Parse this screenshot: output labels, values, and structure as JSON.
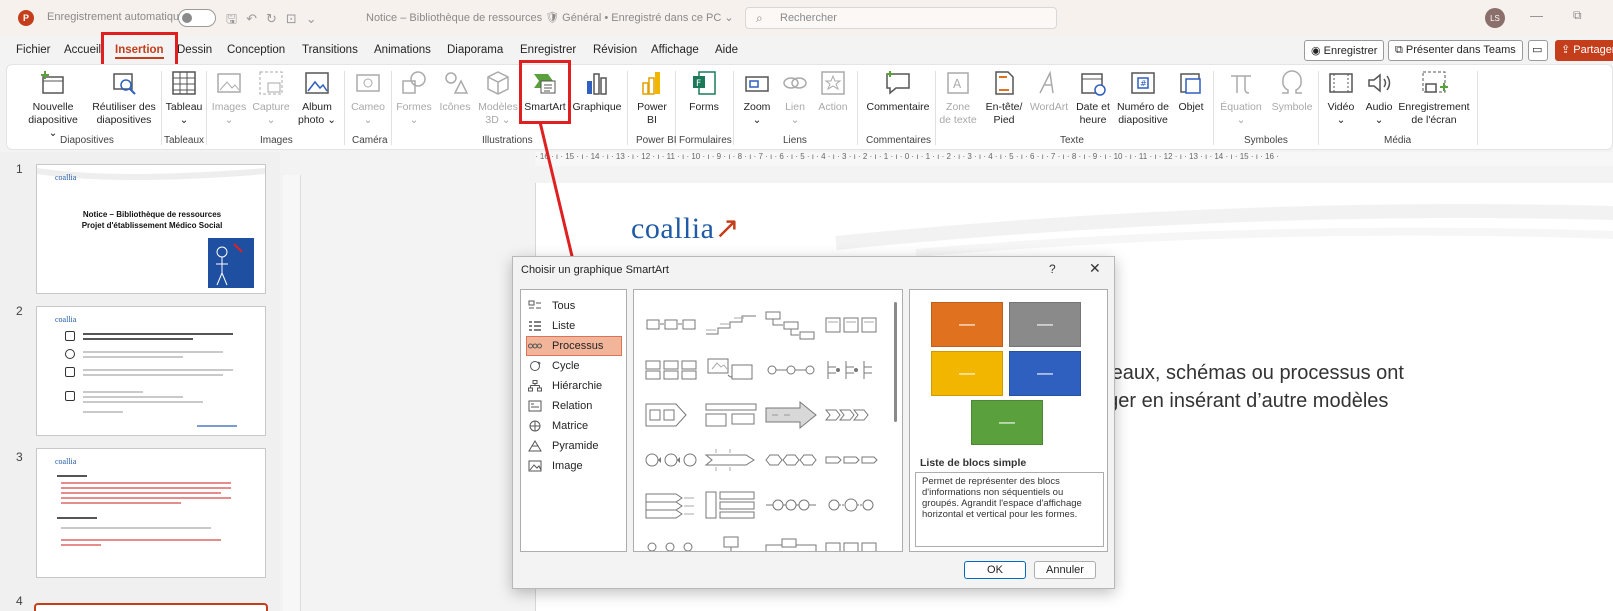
{
  "titlebar": {
    "app_logo": "P",
    "autosave": "Enregistrement automatique",
    "doc_title": "Notice – Bibliothèque de ressources  🛡 Général • Enregistré dans ce PC ⌄",
    "search_placeholder": "Rechercher",
    "user_initials": "LS"
  },
  "menu": {
    "tabs": [
      "Fichier",
      "Accueil",
      "Insertion",
      "Dessin",
      "Conception",
      "Transitions",
      "Animations",
      "Diaporama",
      "Enregistrer",
      "Révision",
      "Affichage",
      "Aide"
    ],
    "record_btn": "Enregistrer",
    "teams_btn": "Présenter dans Teams",
    "share_btn": "Partager"
  },
  "ribbon": {
    "buttons": {
      "nouvelle_diapo": [
        "Nouvelle",
        "diapositive ⌄"
      ],
      "reutiliser": [
        "Réutiliser des",
        "diapositives"
      ],
      "tableau": [
        "Tableau",
        "⌄"
      ],
      "images": [
        "Images",
        "⌄"
      ],
      "capture": [
        "Capture",
        "⌄"
      ],
      "album": [
        "Album",
        "photo ⌄"
      ],
      "cameo": [
        "Cameo",
        "⌄"
      ],
      "formes": [
        "Formes",
        "⌄"
      ],
      "icones": [
        "Icônes"
      ],
      "modeles3d": [
        "Modèles",
        "3D ⌄"
      ],
      "smartart": [
        "SmartArt"
      ],
      "graphique": [
        "Graphique"
      ],
      "powerbi": [
        "Power",
        "BI"
      ],
      "forms": [
        "Forms"
      ],
      "zoom": [
        "Zoom",
        "⌄"
      ],
      "lien": [
        "Lien",
        "⌄"
      ],
      "action": [
        "Action"
      ],
      "commentaire": [
        "Commentaire"
      ],
      "zone_texte": [
        "Zone",
        "de texte"
      ],
      "entete": [
        "En-tête/",
        "Pied"
      ],
      "wordart": [
        "WordArt"
      ],
      "date_heure": [
        "Date et",
        "heure"
      ],
      "numero": [
        "Numéro de",
        "diapositive"
      ],
      "objet": [
        "Objet"
      ],
      "equation": [
        "Équation",
        "⌄"
      ],
      "symbole": [
        "Symbole"
      ],
      "video": [
        "Vidéo",
        "⌄"
      ],
      "audio": [
        "Audio",
        "⌄"
      ],
      "enreg_ecran": [
        "Enregistrement",
        "de l'écran"
      ]
    },
    "groups": [
      "Diapositives",
      "Tableaux",
      "Images",
      "Caméra",
      "Illustrations",
      "Power BI",
      "Formulaires",
      "Liens",
      "Commentaires",
      "Texte",
      "Symboles",
      "Média"
    ]
  },
  "thumbnails": {
    "numbers": [
      "1",
      "2",
      "3",
      "4"
    ],
    "logo": "coallia",
    "slide1_title": "Notice – Bibliothèque de ressources\nProjet d'établissement Médico Social"
  },
  "ruler": {
    "labels": "· 16 · ı · 15 · ı · 14 · ı · 13 · ı · 12 · ı · 11 · ı · 10 · ı · 9 · ı · 8 · ı · 7 · ı · 6 · ı · 5 · ı · 4 · ı · 3 · ı · 2 · ı · 1 · ı · 0 · ı · 1 · ı · 2 · ı · 3 · ı · 4 · ı · 5 · ı · 6 · ı · 7 · ı · 8 · ı · 9 · ı · 10 · ı · 11 · ı · 12 · ı · 13 · ı · 14 · ı · 15 · ı · 16 ·"
  },
  "slide": {
    "logo": "coallia",
    "logo_mark": "↗",
    "text_line1": "bleaux, schémas ou processus ont",
    "text_line2": "nger  en  insérant  d’autre  modèles"
  },
  "dialog": {
    "title": "Choisir un graphique SmartArt",
    "help": "?",
    "close": "✕",
    "categories": [
      "Tous",
      "Liste",
      "Processus",
      "Cycle",
      "Hiérarchie",
      "Relation",
      "Matrice",
      "Pyramide",
      "Image"
    ],
    "selected_category": "Processus",
    "preview_name": "Liste de blocs simple",
    "preview_desc": "Permet de représenter des blocs d'informations non séquentiels ou groupés. Agrandit l'espace d'affichage horizontal et vertical pour les formes.",
    "ok": "OK",
    "cancel": "Annuler",
    "block_colors": [
      "#e0711f",
      "#8a8a8a",
      "#f2b500",
      "#2f5fbf",
      "#5aa03c"
    ],
    "block_glyph": "—"
  },
  "colors": {
    "accent": "#c43e1c",
    "highlight_red": "#e02020"
  }
}
